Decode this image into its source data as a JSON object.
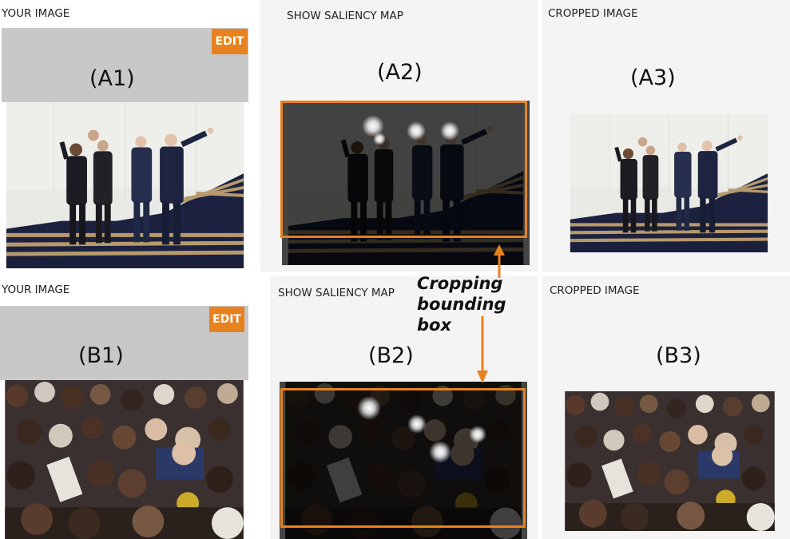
{
  "rowA": {
    "col1": {
      "header": "YOUR IMAGE",
      "edit_label": "EDIT",
      "panel_label": "(A1)"
    },
    "col2": {
      "header": "SHOW SALIENCY MAP",
      "panel_label": "(A2)"
    },
    "col3": {
      "header": "CROPPED IMAGE",
      "panel_label": "(A3)"
    }
  },
  "rowB": {
    "col1": {
      "header": "YOUR IMAGE",
      "edit_label": "EDIT",
      "panel_label": "(B1)"
    },
    "col2": {
      "header": "SHOW SALIENCY MAP",
      "panel_label": "(B2)"
    },
    "col3": {
      "header": "CROPPED IMAGE",
      "panel_label": "(B3)"
    }
  },
  "annotation": {
    "line1": "Cropping",
    "line2": "bounding",
    "line3": "box"
  },
  "colors": {
    "accent_orange": "#e8821f",
    "panel_bg": "#f4f4f4",
    "gray_placeholder": "#c8c8c8"
  }
}
